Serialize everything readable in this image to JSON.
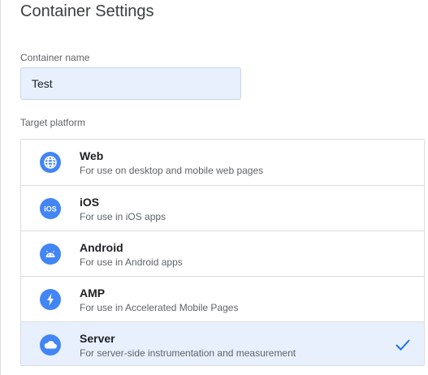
{
  "page": {
    "title": "Container Settings"
  },
  "container_name": {
    "label": "Container name",
    "value": "Test"
  },
  "target_platform": {
    "label": "Target platform",
    "selected": "Server",
    "options": [
      {
        "name": "Web",
        "description": "For use on desktop and mobile web pages",
        "icon": "globe-icon"
      },
      {
        "name": "iOS",
        "description": "For use in iOS apps",
        "icon": "ios-icon"
      },
      {
        "name": "Android",
        "description": "For use in Android apps",
        "icon": "android-icon"
      },
      {
        "name": "AMP",
        "description": "For use in Accelerated Mobile Pages",
        "icon": "lightning-icon"
      },
      {
        "name": "Server",
        "description": "For server-side instrumentation and measurement",
        "icon": "cloud-icon"
      }
    ]
  },
  "colors": {
    "accent": "#4285f4",
    "selected_background": "#e8f0fe",
    "checkmark": "#1a73e8"
  }
}
